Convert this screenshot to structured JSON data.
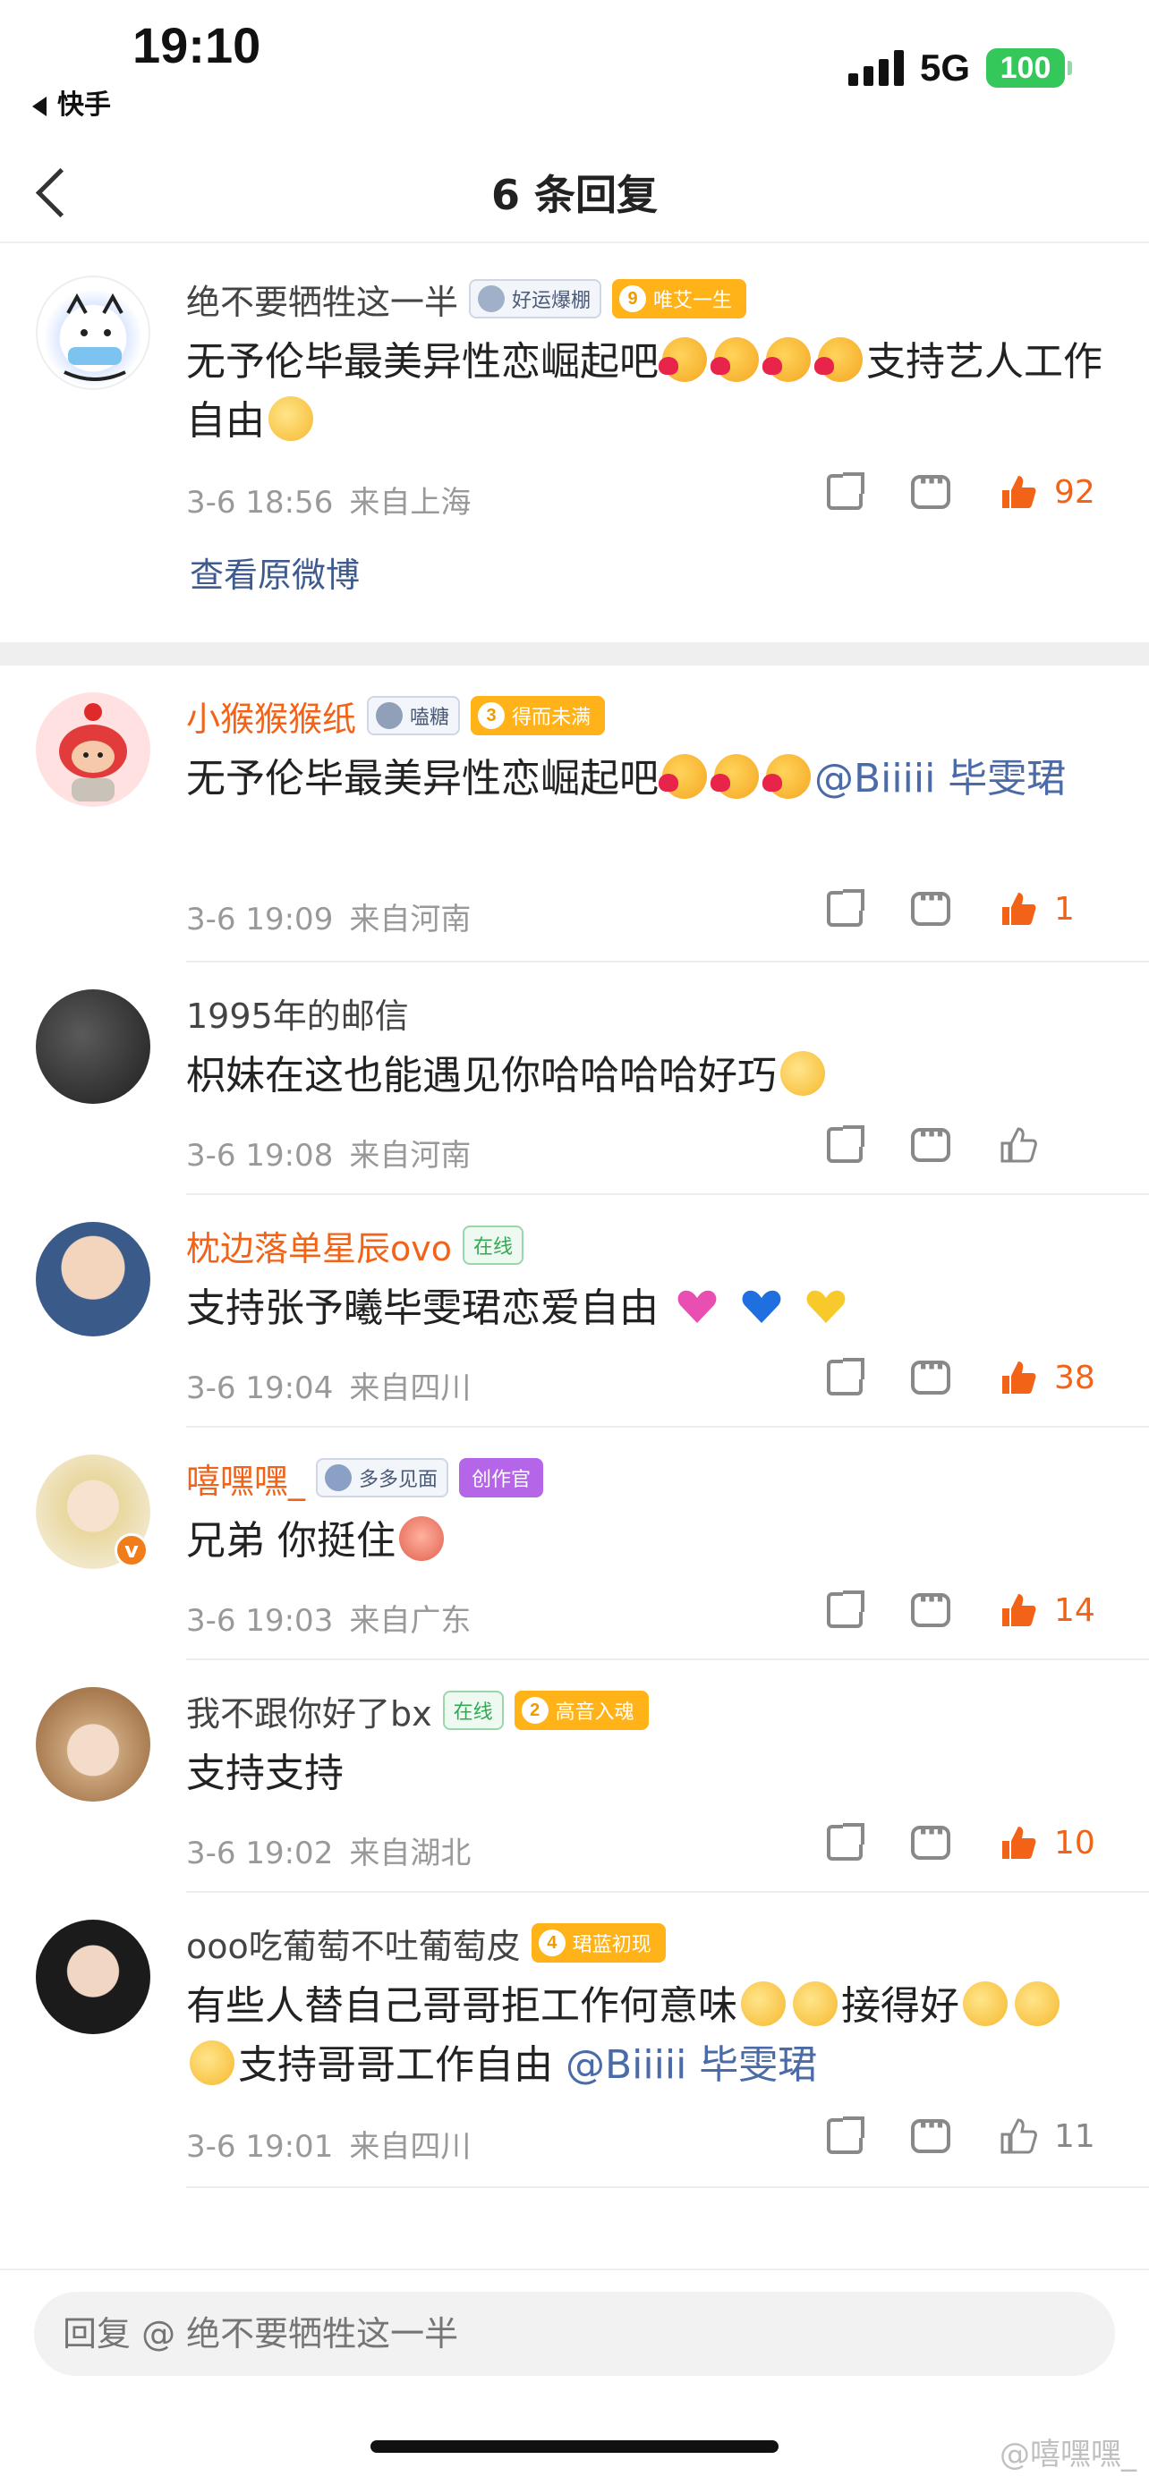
{
  "status_bar": {
    "time": "19:10",
    "back_app": "快手",
    "network": "5G",
    "battery": "100"
  },
  "header": {
    "title": "6 条回复"
  },
  "comments": [
    {
      "name": "绝不要牺牲这一半",
      "badges": [
        "好运爆棚",
        "唯艾一生"
      ],
      "fan_level": "9",
      "text_a": "无予伦毕最美异性恋崛起吧",
      "text_b": "支持艺人工作自由",
      "date": "3-6 18:56",
      "location": "来自上海",
      "likes": "92",
      "view_original": "查看原微博"
    },
    {
      "name": "小猴猴猴纸",
      "badges": [
        "嗑糖",
        "得而未满"
      ],
      "fan_level": "3",
      "text_a": "无予伦毕最美异性恋崛起吧",
      "mention": "@Biiiii 毕雯珺",
      "date": "3-6 19:09",
      "location": "来自河南",
      "likes": "1"
    },
    {
      "name": "1995年的邮信",
      "text_a": "枳妹在这也能遇见你哈哈哈哈好巧",
      "date": "3-6 19:08",
      "location": "来自河南",
      "likes": ""
    },
    {
      "name": "枕边落单星辰ovo",
      "badges": [
        "在线"
      ],
      "text_a": "支持张予曦毕雯珺恋爱自由",
      "date": "3-6 19:04",
      "location": "来自四川",
      "likes": "38"
    },
    {
      "name": "嘻嘿嘿_",
      "badges": [
        "多多见面",
        "创作官"
      ],
      "text_a": "兄弟 你挺住",
      "date": "3-6 19:03",
      "location": "来自广东",
      "likes": "14"
    },
    {
      "name": "我不跟你好了bx",
      "badges": [
        "在线",
        "高音入魂"
      ],
      "fan_level": "2",
      "text_a": "支持支持",
      "date": "3-6 19:02",
      "location": "来自湖北",
      "likes": "10"
    },
    {
      "name": "ooo吃葡萄不吐葡萄皮",
      "badges": [
        "珺蓝初现"
      ],
      "fan_level": "4",
      "text_a": "有些人替自己哥哥拒工作何意味",
      "text_b": "接得好",
      "text_c": "支持哥哥工作自由",
      "mention": "@Biiiii 毕雯珺",
      "date": "3-6 19:01",
      "location": "来自四川",
      "likes": "11"
    }
  ],
  "reply_bar": {
    "placeholder": "回复 @ 绝不要牺牲这一半"
  },
  "watermark": "@嘻嘿嘿_",
  "colors": {
    "like_active": "#f26318",
    "mention": "#4b6aa8",
    "fan_badge": "#ffb319"
  }
}
